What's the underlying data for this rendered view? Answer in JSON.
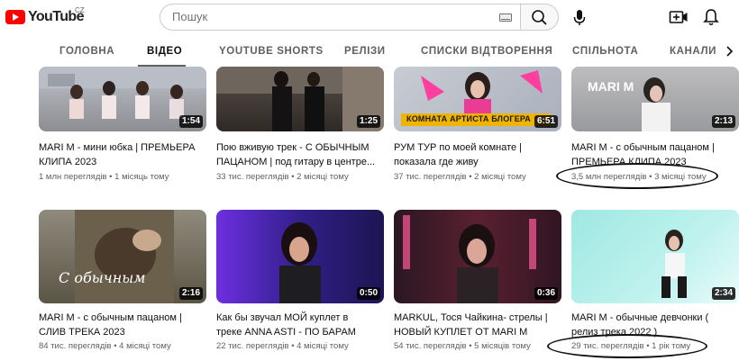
{
  "header": {
    "logo_text": "YouTube",
    "country_code": "CZ",
    "search_placeholder": "Пошук"
  },
  "tabs": [
    {
      "label": "ГОЛОВНА",
      "active": false
    },
    {
      "label": "ВІДЕО",
      "active": true
    },
    {
      "label": "YOUTUBE SHORTS",
      "active": false
    },
    {
      "label": "РЕЛІЗИ",
      "active": false
    },
    {
      "label": "СПИСКИ ВІДТВОРЕННЯ",
      "active": false
    },
    {
      "label": "СПІЛЬНОТА",
      "active": false
    },
    {
      "label": "КАНАЛИ",
      "active": false
    }
  ],
  "videos": [
    {
      "duration": "1:54",
      "title_line1": "MARI M - мини юбка | ПРЕМЬЕРА",
      "title_line2": "КЛИПА 2023",
      "views": "1 млн переглядів",
      "age": "1 місяць тому",
      "thumb_text": ""
    },
    {
      "duration": "1:25",
      "title_line1": "Пою вживую трек - С ОБЫЧНЫМ",
      "title_line2": "ПАЦАНОМ | под гитару в центре...",
      "views": "33 тис. переглядів",
      "age": "2 місяці тому",
      "thumb_text": ""
    },
    {
      "duration": "6:51",
      "title_line1": "РУМ ТУР по моей комнате |",
      "title_line2": "показала где живу",
      "views": "37 тис. переглядів",
      "age": "2 місяці тому",
      "thumb_text": "КОМНАТА АРТИСТА БЛОГЕРА"
    },
    {
      "duration": "2:13",
      "title_line1": "MARI M - с обычным пацаном |",
      "title_line2": "ПРЕМЬЕРА КЛИПА 2023",
      "views": "3,5 млн переглядів",
      "age": "3 місяці тому",
      "thumb_text": "MARI M"
    },
    {
      "duration": "2:16",
      "title_line1": "MARI M - с обычным пацаном |",
      "title_line2": "СЛИВ ТРЕКА 2023",
      "views": "84 тис. переглядів",
      "age": "4 місяці тому",
      "thumb_text": "С обычным"
    },
    {
      "duration": "0:50",
      "title_line1": "Как бы звучал МОЙ куплет в",
      "title_line2": "треке ANNA ASTI - ПО БАРАМ",
      "views": "22 тис. переглядів",
      "age": "4 місяці тому",
      "thumb_text": ""
    },
    {
      "duration": "0:36",
      "title_line1": "MARKUL, Тося Чайкина- стрелы |",
      "title_line2": "НОВЫЙ КУПЛЕТ ОТ MARI M",
      "views": "54 тис. переглядів",
      "age": "5 місяців тому",
      "thumb_text": ""
    },
    {
      "duration": "2:34",
      "title_line1": "MARI M - обычные девчонки (",
      "title_line2": "релиз трека 2022 )",
      "views": "29 тис. переглядів",
      "age": "1 рік тому",
      "thumb_text": ""
    }
  ],
  "separator": "•"
}
